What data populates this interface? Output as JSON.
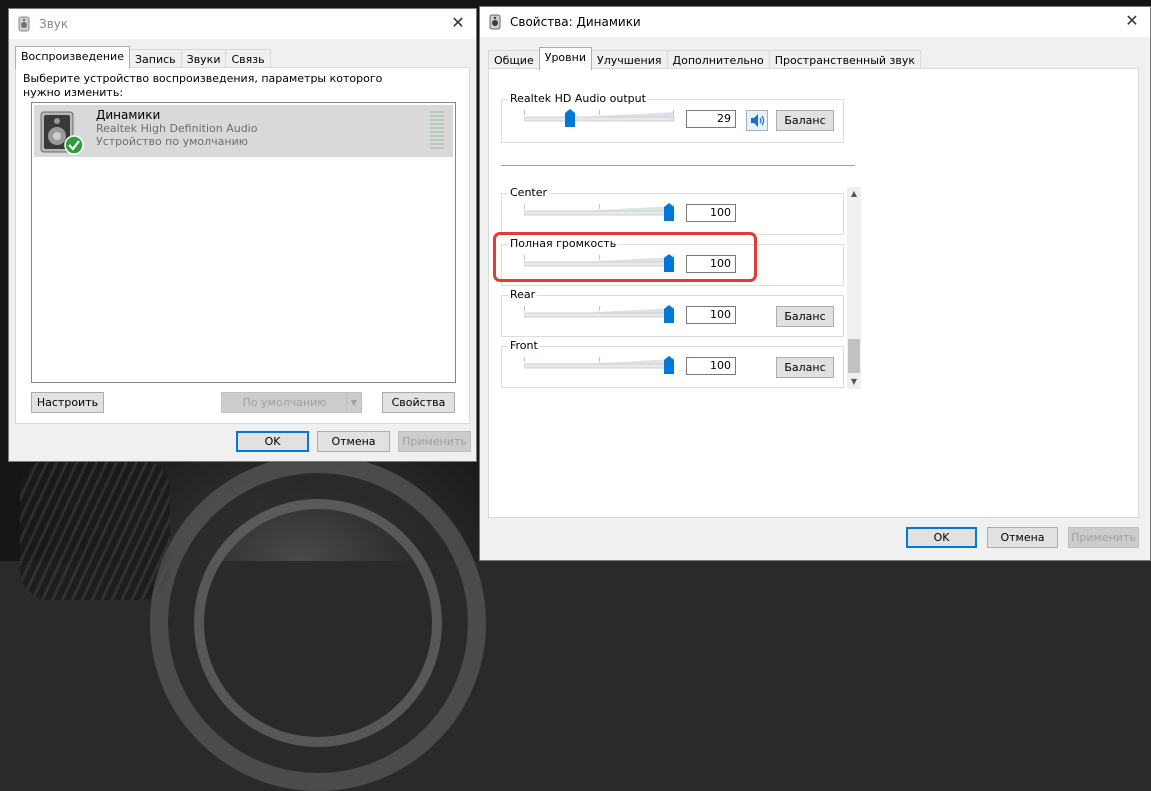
{
  "sound_window": {
    "title": "Звук",
    "tabs": [
      {
        "label": "Воспроизведение",
        "active": true
      },
      {
        "label": "Запись",
        "active": false
      },
      {
        "label": "Звуки",
        "active": false
      },
      {
        "label": "Связь",
        "active": false
      }
    ],
    "instruction": "Выберите устройство воспроизведения, параметры которого нужно изменить:",
    "device": {
      "name": "Динамики",
      "driver": "Realtek High Definition Audio",
      "status": "Устройство по умолчанию"
    },
    "configure_button": "Настроить",
    "default_button": "По умолчанию",
    "properties_button": "Свойства",
    "ok_button": "OK",
    "cancel_button": "Отмена",
    "apply_button": "Применить"
  },
  "props_window": {
    "title": "Свойства: Динамики",
    "tabs": [
      {
        "label": "Общие",
        "active": false
      },
      {
        "label": "Уровни",
        "active": true
      },
      {
        "label": "Улучшения",
        "active": false
      },
      {
        "label": "Дополнительно",
        "active": false
      },
      {
        "label": "Пространственный звук",
        "active": false
      }
    ],
    "master": {
      "label": "Realtek HD Audio output",
      "value": "29",
      "level": 29,
      "balance_button": "Баланс"
    },
    "channels": [
      {
        "label": "Center",
        "value": "100",
        "level": 100,
        "balance_button": null,
        "highlighted": false
      },
      {
        "label": "Полная громкость",
        "value": "100",
        "level": 100,
        "balance_button": null,
        "highlighted": true
      },
      {
        "label": "Rear",
        "value": "100",
        "level": 100,
        "balance_button": "Баланс",
        "highlighted": false
      },
      {
        "label": "Front",
        "value": "100",
        "level": 100,
        "balance_button": "Баланс",
        "highlighted": false
      }
    ],
    "ok_button": "OK",
    "cancel_button": "Отмена",
    "apply_button": "Применить"
  },
  "colors": {
    "accent": "#0078d7",
    "highlight_border": "#e03c31",
    "default_check": "#2e9e3e"
  }
}
